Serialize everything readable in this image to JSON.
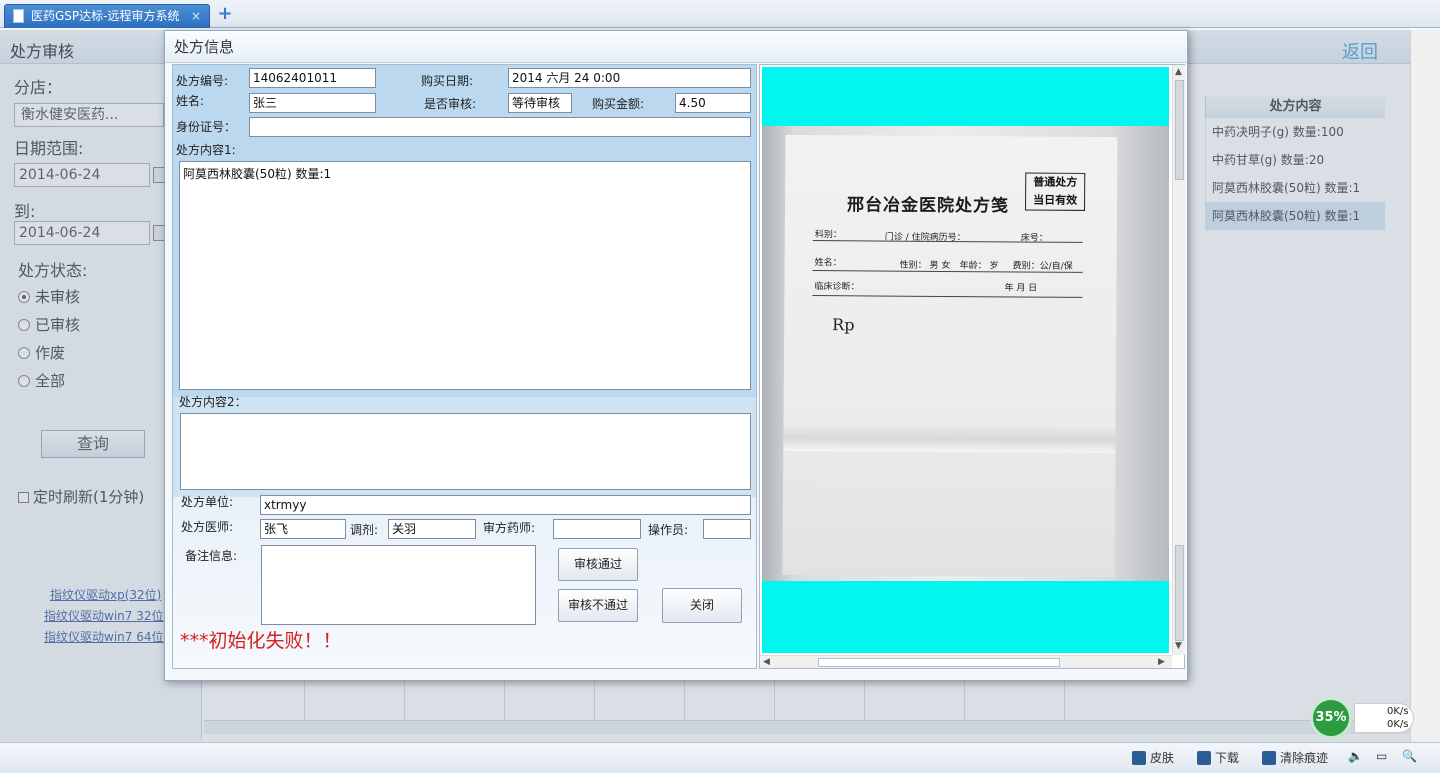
{
  "browser": {
    "tab_title": "医药GSP达标-远程审方系统",
    "tab_close": "×",
    "new_tab": "+"
  },
  "page": {
    "title": "处方审核",
    "back": "返回"
  },
  "left_panel": {
    "store_label": "分店：",
    "store_value": "衡水健安医药...",
    "date_range_label": "日期范围:",
    "date_from": "2014-06-24",
    "to_label": "到:",
    "date_to": "2014-06-24",
    "status_label": "处方状态:",
    "status_options": [
      "未审核",
      "已审核",
      "作废",
      "全部"
    ],
    "query_button": "查询",
    "auto_refresh": "定时刷新(1分钟)",
    "driver_links": [
      "指纹仪驱动xp(32位)",
      "指纹仪驱动win7 32位",
      "指纹仪驱动win7 64位"
    ]
  },
  "grid": {
    "header": "处方内容",
    "rows": [
      "中药决明子(g)  数量:100",
      "中药甘草(g)  数量:20",
      "阿莫西林胶囊(50粒)  数量:1",
      "阿莫西林胶囊(50粒)  数量:1"
    ]
  },
  "dialog": {
    "title": "处方信息",
    "fields": {
      "rx_no_label": "处方编号:",
      "rx_no": "14062401011",
      "purchase_date_label": "购买日期:",
      "purchase_date": "2014 六月 24  0:00",
      "name_label": "姓名:",
      "name": "张三",
      "reviewed_label": "是否审核:",
      "reviewed": "等待审核",
      "amount_label": "购买金额:",
      "amount": "4.50",
      "id_label": "身份证号：",
      "id": "",
      "content1_label": "处方内容1:",
      "content1": "阿莫西林胶囊(50粒)   数量:1",
      "content2_label": "处方内容2：",
      "content2": "",
      "unit_label": "处方单位:",
      "unit": "xtrmyy",
      "doctor_label": "处方医师:",
      "doctor": "张飞",
      "dispenser_label": "调剂:",
      "dispenser": "关羽",
      "pharmacist_label": "审方药师:",
      "pharmacist": "",
      "operator_label": "操作员:",
      "operator": "",
      "remark_label": "备注信息:",
      "remark": ""
    },
    "buttons": {
      "approve": "审核通过",
      "reject": "审核不通过",
      "close": "关闭"
    },
    "error": "***初始化失败！！"
  },
  "prescription_image": {
    "hospital_title": "邢台冶金医院处方笺",
    "stamp_line1": "普通处方",
    "stamp_line2": "当日有效",
    "dept": "科别：",
    "clinic_no": "门诊 / 住院病历号：",
    "bed": "床号：",
    "patient_name": "姓名：",
    "gender": "性别： 男 女",
    "age": "年龄：    岁",
    "fee": "费别：公/自/保",
    "diagnosis": "临床诊断：",
    "date": "年    月    日",
    "rp": "Rp"
  },
  "statusbar": {
    "skin": "皮肤",
    "download": "下载",
    "clear": "清除痕迹"
  },
  "speed": {
    "percent": "35%",
    "up": "0K/s",
    "down": "0K/s"
  },
  "colors": {
    "cyan_bg": "#00f7ef",
    "error_red": "#d42020",
    "tab_blue": "#2d6fbf"
  }
}
